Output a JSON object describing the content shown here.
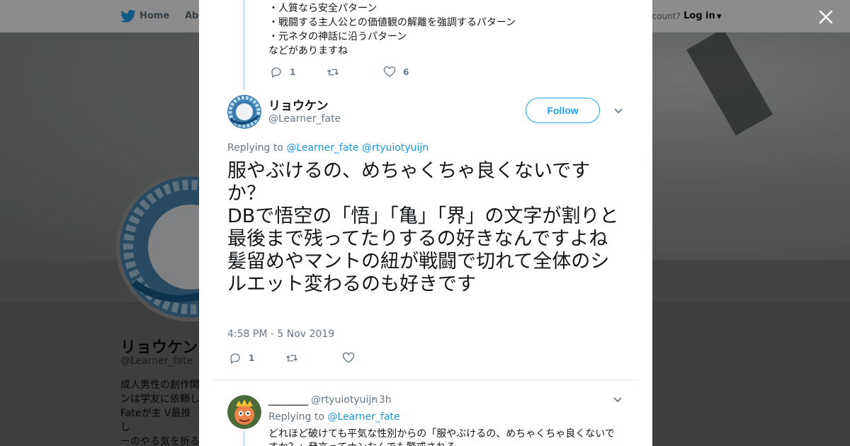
{
  "background": {
    "nav": {
      "home": "Home",
      "about": "Abo",
      "account": "ccount?",
      "login": "Log in"
    },
    "profile": {
      "name": "リョウケン",
      "handle": "@Learner_fate",
      "bio_lines": [
        "成人男性の創作関",
        "ンは学友に依頼し",
        "Fateが主 V最推し",
        "ーのやる気を折る"
      ]
    }
  },
  "previous_tweet": {
    "lines": [
      "・人質なら安全パターン",
      "・戦闘する主人公との価値観の解離を強調するパターン",
      "・元ネタの神話に沿うパターン",
      "などがありますね"
    ],
    "reply_count": "1",
    "like_count": "6"
  },
  "main_tweet": {
    "name": "リョウケン",
    "handle": "@Learner_fate",
    "follow_label": "Follow",
    "replying_prefix": "Replying to",
    "replying_to": [
      "@Learner_fate",
      "@rtyuiotyuijn"
    ],
    "text": "服やぶけるの、めちゃくちゃ良くないですか？\nDBで悟空の「悟」「亀」「界」の文字が割りと最後まで残ってたりするの好きなんですよね\n髪留めやマントの紐が戦闘で切れて全体のシルエット変わるのも好きです",
    "timestamp": "4:58 PM - 5 Nov 2019",
    "reply_count": "1"
  },
  "reply_tweet": {
    "name": "＿＿＿＿",
    "handle": "@rtyuiotyuijn",
    "time": "· 3h",
    "replying_prefix": "Replying to",
    "replying_to": "@Learner_fate",
    "text": "どれほど破けても平気な性別からの「服やぶけるの、めちゃくちゃ良くないですか？」発言ってナンなんでも警戒される"
  },
  "colors": {
    "accent": "#1da1f2",
    "link": "#1b95e0",
    "muted": "#657786",
    "thread_line": "#cce8f7"
  },
  "icons": [
    "twitter-bird-icon",
    "close-icon",
    "reply-icon",
    "retweet-icon",
    "like-icon",
    "chevron-down-icon"
  ]
}
